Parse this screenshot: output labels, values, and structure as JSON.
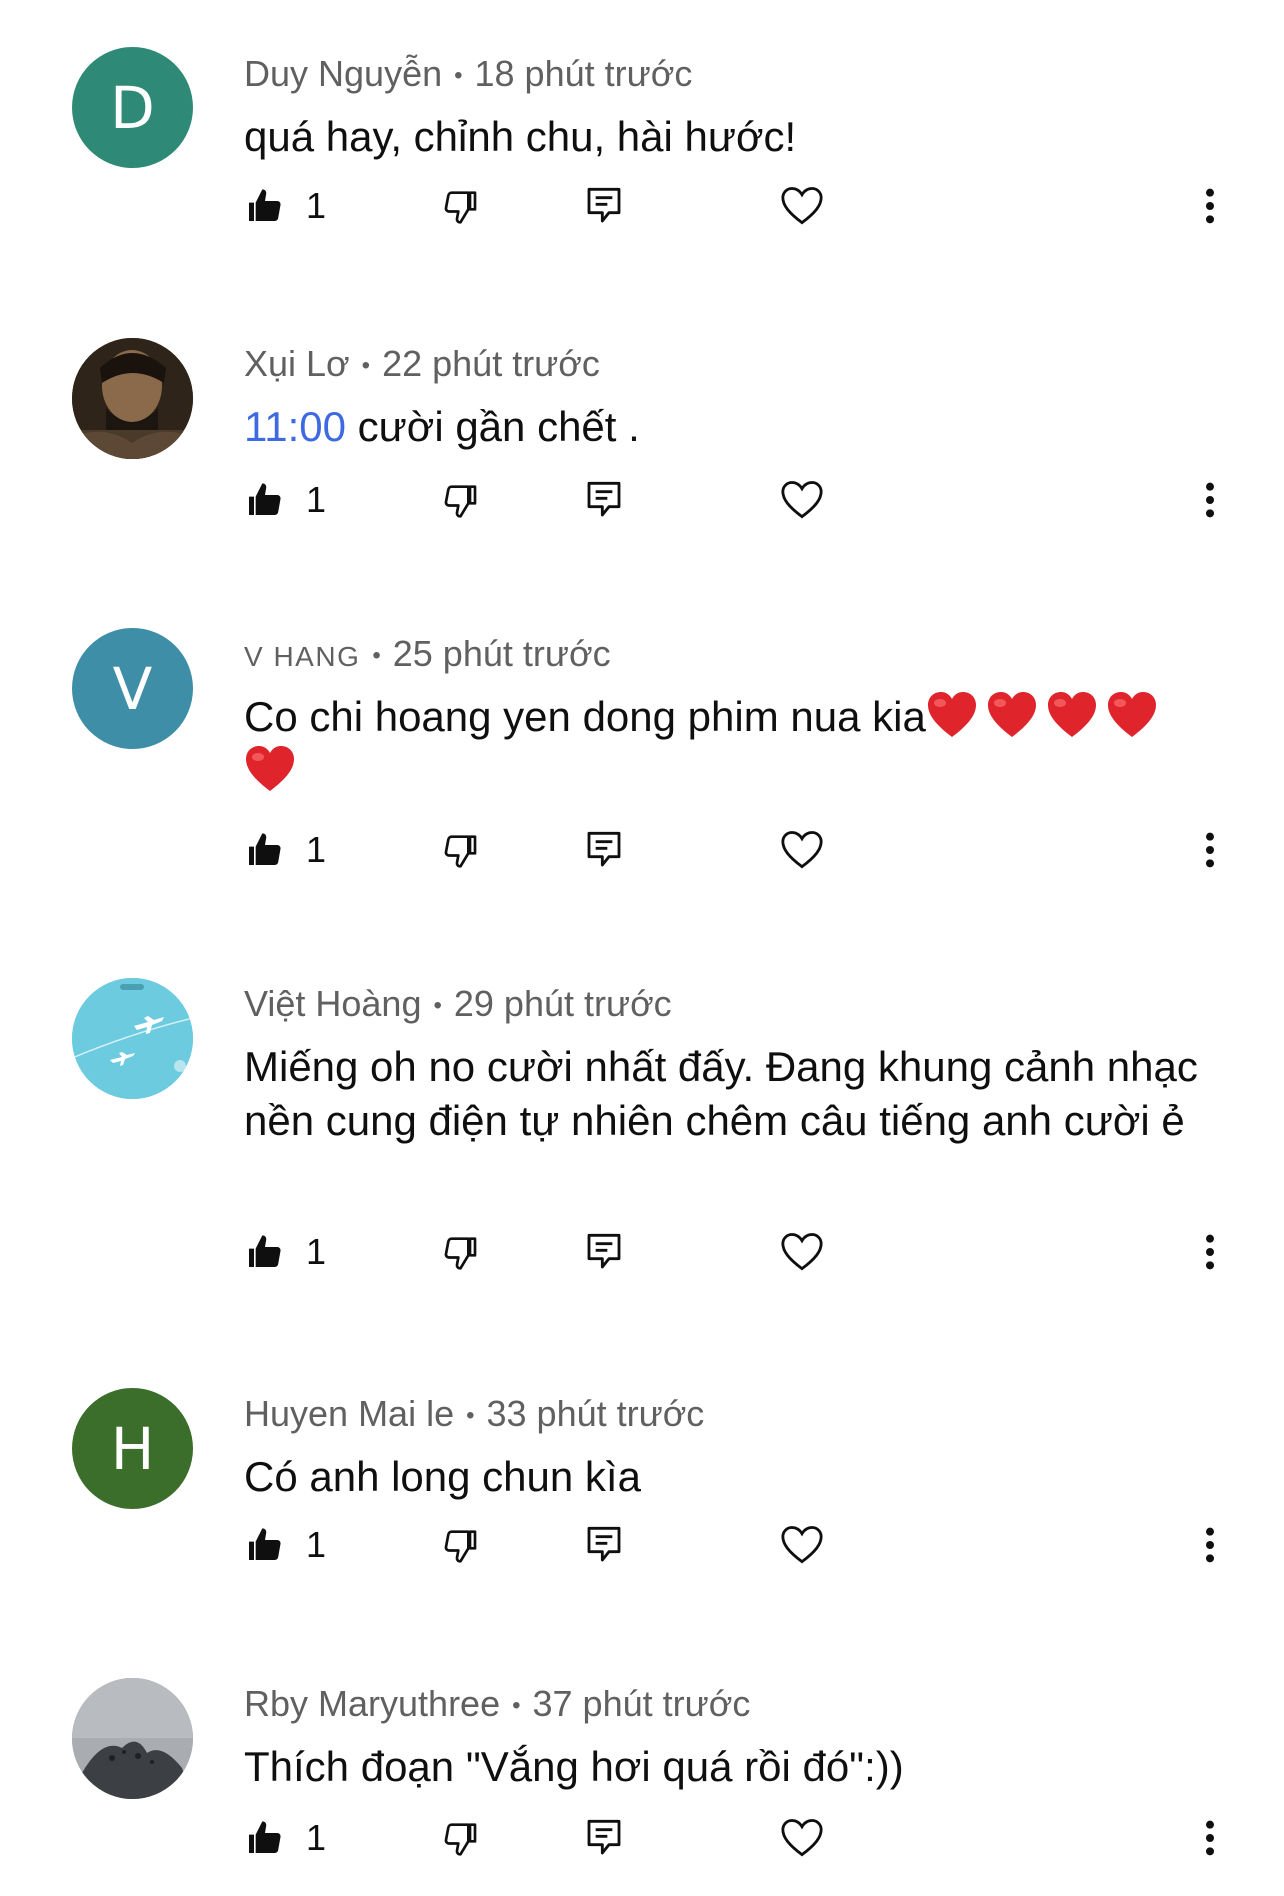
{
  "comments": [
    {
      "author": "Duy Nguyễn",
      "time": "18 phút trước",
      "text": "quá hay, chỉnh chu, hài hước!",
      "likes": "1",
      "avatar_letter": "D",
      "avatar_color": "#2e8a76"
    },
    {
      "author": "Xụi Lơ",
      "time": "22 phút trước",
      "timestamp_link": "11:00",
      "text": " cười gần chết .",
      "likes": "1",
      "avatar_type": "photo"
    },
    {
      "author": "V HANG",
      "time": "25 phút trước",
      "text": "Co chi hoang yen dong phim nua kia",
      "likes": "1",
      "avatar_letter": "V",
      "avatar_color": "#3d8ea6",
      "emoji": "red-heart"
    },
    {
      "author": "Việt Hoàng",
      "time": "29 phút trước",
      "text": "Miếng oh no cười nhất đấy. Đang khung cảnh nhạc nền cung điện tự nhiên chêm câu tiếng anh cười ẻ",
      "likes": "1",
      "avatar_type": "image",
      "avatar_color": "#6ccbdf"
    },
    {
      "author": "Huyen Mai le",
      "time": "33 phút trước",
      "text": "Có anh long chun kìa",
      "likes": "1",
      "avatar_letter": "H",
      "avatar_color": "#3b6e2a"
    },
    {
      "author": "Rby Maryuthree",
      "time": "37 phút trước",
      "text": "Thích đoạn \"Vắng hơi quá rồi đó\":))",
      "likes": "1",
      "avatar_type": "image",
      "avatar_color": "#9a9ea3"
    }
  ],
  "icons": {
    "like": "thumbs-up-icon",
    "dislike": "thumbs-down-icon",
    "reply": "reply-icon",
    "heart": "heart-icon",
    "more": "more-vertical-icon"
  }
}
